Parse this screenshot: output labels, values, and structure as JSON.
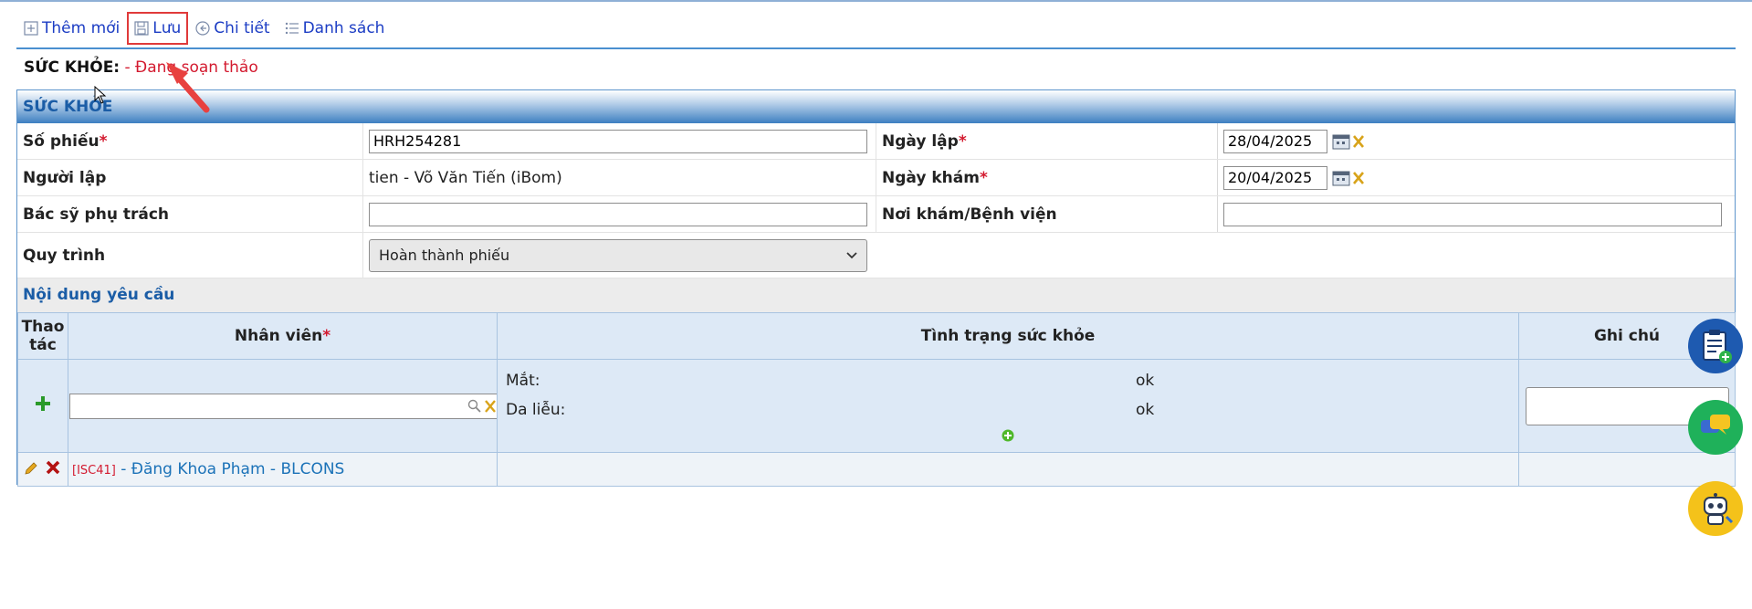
{
  "toolbar": {
    "add_label": "Thêm mới",
    "save_label": "Lưu",
    "detail_label": "Chi tiết",
    "list_label": "Danh sách"
  },
  "status": {
    "label": "SỨC KHỎE:",
    "value": "- Đang soạn thảo"
  },
  "panel": {
    "title": "SỨC KHỎE",
    "fields": {
      "so_phieu_label": "Số phiếu",
      "so_phieu_value": "HRH254281",
      "ngay_lap_label": "Ngày lập",
      "ngay_lap_value": "28/04/2025",
      "nguoi_lap_label": "Người lập",
      "nguoi_lap_value": "tien - Võ Văn Tiến (iBom)",
      "ngay_kham_label": "Ngày khám",
      "ngay_kham_value": "20/04/2025",
      "bac_si_label": "Bác sỹ phụ trách",
      "bac_si_value": "",
      "noi_kham_label": "Nơi khám/Bệnh viện",
      "noi_kham_value": "",
      "quy_trinh_label": "Quy trình",
      "quy_trinh_value": "Hoàn thành phiếu"
    },
    "required_mark": "*"
  },
  "request": {
    "section_title": "Nội dung yêu cầu",
    "columns": {
      "action": "Thao tác",
      "employee": "Nhân viên",
      "health": "Tình trạng sức khỏe",
      "note": "Ghi chú"
    },
    "edit_row": {
      "health_items": [
        {
          "label": "Mắt:",
          "value": "ok"
        },
        {
          "label": "Da liễu:",
          "value": "ok"
        }
      ]
    },
    "rows": [
      {
        "code": "[ISC41]",
        "name": "- Đăng Khoa Phạm - BLCONS"
      }
    ]
  },
  "colors": {
    "link": "#1c3dc4",
    "required": "#d31a2f",
    "header_blue": "#1b5da6",
    "highlight": "#e03a3a"
  }
}
